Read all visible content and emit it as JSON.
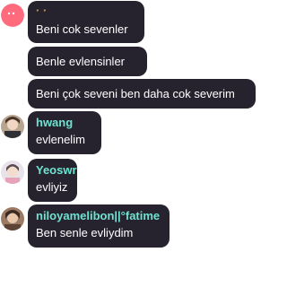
{
  "colors": {
    "bubble": "#26222e",
    "message_text": "#ffffff",
    "username_gold": "#c8a24a",
    "username_teal": "#6fe3d2",
    "page_background": "#ffffff"
  },
  "messages": [
    {
      "username": "· ·",
      "username_color": "#c8a24a",
      "text": "Beni cok sevenler",
      "avatar": "pink-blob-avatar"
    },
    {
      "text": "Benle evlensinler"
    },
    {
      "text": "Beni çok seveni ben daha cok severim"
    },
    {
      "username": "hwang",
      "username_color": "#6fe3d2",
      "text": "evlenelim",
      "avatar": "user-photo-avatar"
    },
    {
      "username": "Yeoswr",
      "username_color": "#6fe3d2",
      "text": "evliyiz",
      "avatar": "user-photo-avatar"
    },
    {
      "username": "niloyamelibon||°fatime",
      "username_color": "#6fe3d2",
      "text": "Ben senle evliydim",
      "avatar": "user-photo-avatar"
    }
  ]
}
